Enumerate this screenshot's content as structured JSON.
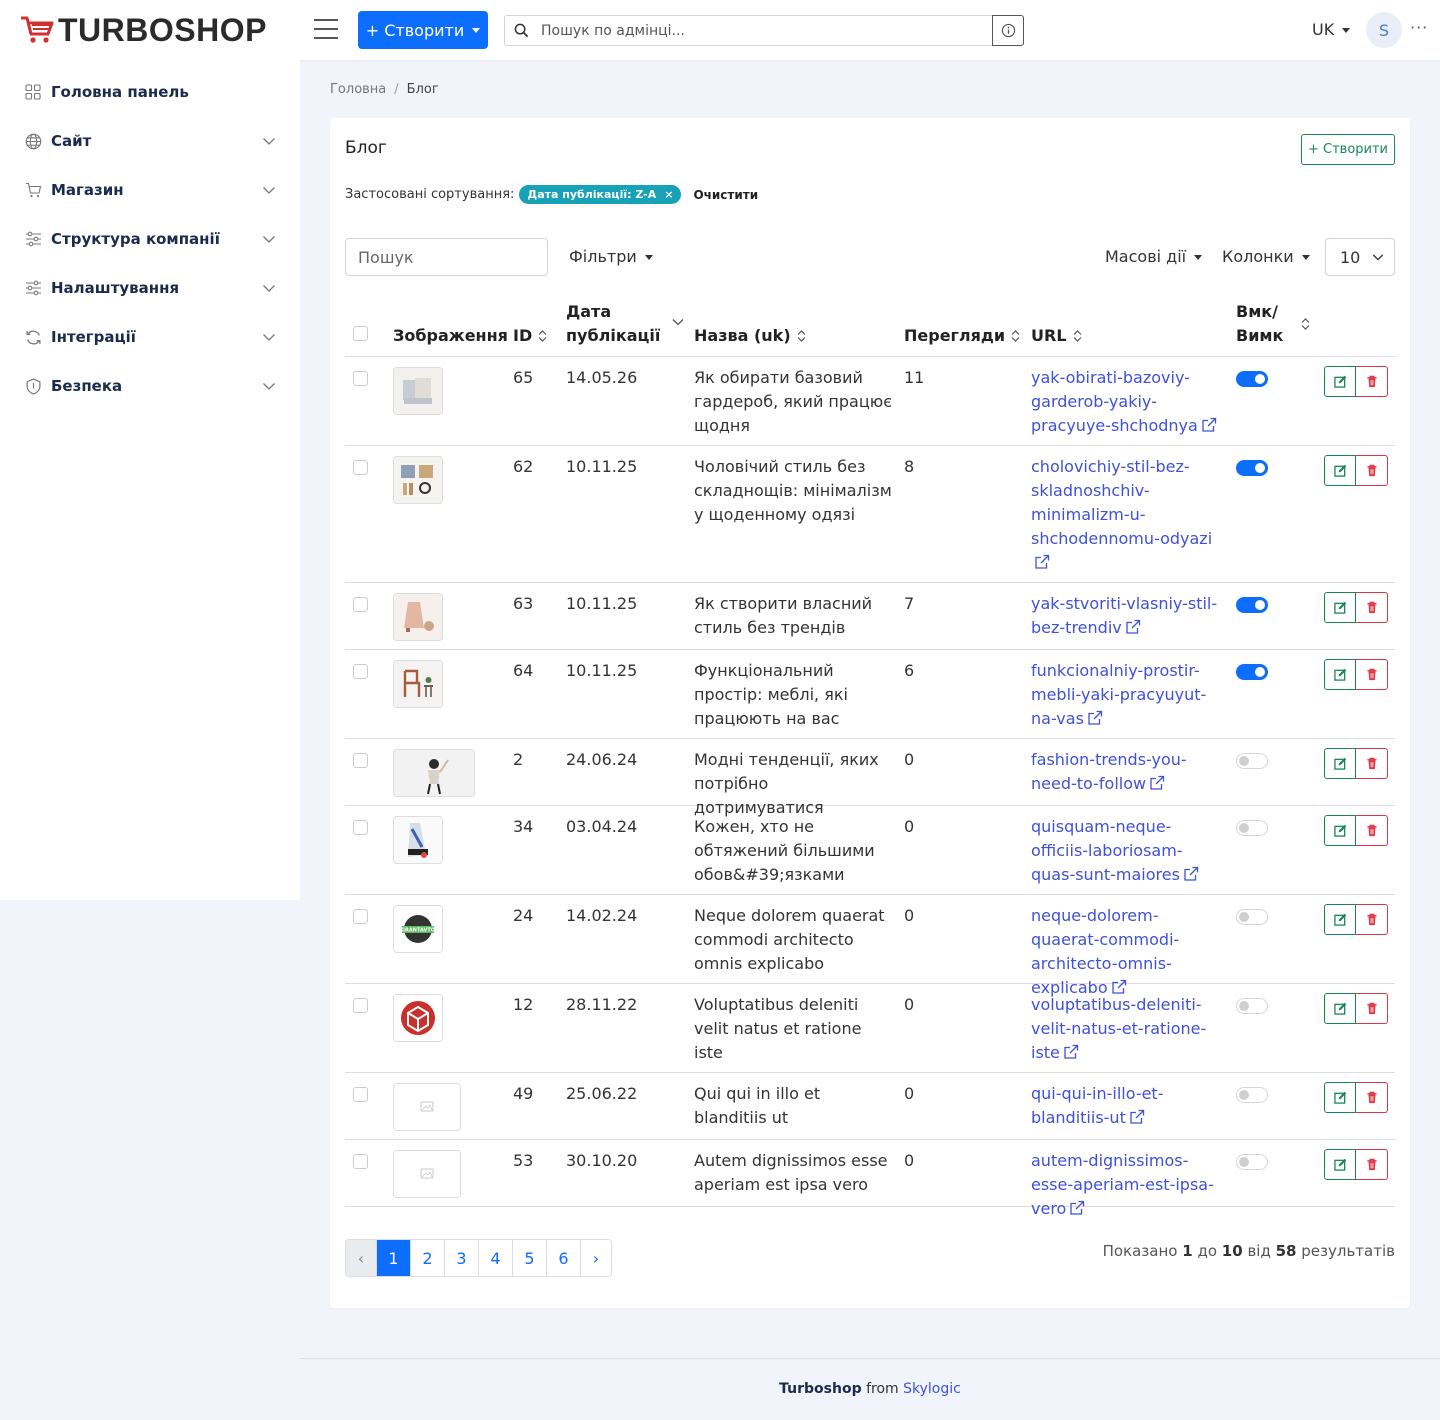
{
  "header": {
    "logo_text": "TURBOSHOP",
    "create_label": "+ Створити",
    "search_placeholder": "Пошук по адмінці...",
    "lang": "UK",
    "avatar_initial": "S",
    "more": "···"
  },
  "sidebar": {
    "items": [
      {
        "label": "Головна панель",
        "icon": "grid-icon",
        "has_children": false
      },
      {
        "label": "Сайт",
        "icon": "globe-icon",
        "has_children": true
      },
      {
        "label": "Магазин",
        "icon": "cart-icon",
        "has_children": true
      },
      {
        "label": "Структура компанії",
        "icon": "sliders-icon",
        "has_children": true
      },
      {
        "label": "Налаштування",
        "icon": "sliders-icon",
        "has_children": true
      },
      {
        "label": "Інтеграції",
        "icon": "sync-icon",
        "has_children": true
      },
      {
        "label": "Безпека",
        "icon": "shield-icon",
        "has_children": true
      }
    ]
  },
  "breadcrumb": {
    "home": "Головна",
    "sep": "/",
    "current": "Блог"
  },
  "card": {
    "title": "Блог",
    "create_label": "+ Створити",
    "applied_sorts_label": "Застосовані сортування:",
    "sort_badge": "Дата публікації: Z-A",
    "sort_badge_close": "×",
    "clear_label": "Очистити",
    "search_placeholder": "Пошук",
    "filters_label": "Фільтри",
    "bulk_label": "Масові дії",
    "columns_label": "Колонки",
    "per_page": "10"
  },
  "table": {
    "columns": {
      "image": "Зображення",
      "id": "ID",
      "date_1": "Дата",
      "date_2": "публікації",
      "name": "Назва (uk)",
      "views": "Перегляди",
      "url": "URL",
      "toggle_1": "Вмк/",
      "toggle_2": "Вимк"
    },
    "rows": [
      {
        "id": "65",
        "date": "14.05.26",
        "name": "Як обирати базовий гардероб, який працює щодня",
        "views": "11",
        "url": "yak-obirati-bazoviy-garderob-yakiy-pracyuye-shchodnya",
        "enabled": true,
        "thumb": "clothes"
      },
      {
        "id": "62",
        "date": "10.11.25",
        "name": "Чоловічий стиль без складнощів: мінімалізм у щоденному одязі",
        "views": "8",
        "url": "cholovichiy-stil-bez-skladnoshchiv-minimalizm-u-shchodennomu-odyazi",
        "enabled": true,
        "thumb": "menswear"
      },
      {
        "id": "63",
        "date": "10.11.25",
        "name": "Як створити власний стиль без трендів",
        "views": "7",
        "url": "yak-stvoriti-vlasniy-stil-bez-trendiv",
        "enabled": true,
        "thumb": "dress"
      },
      {
        "id": "64",
        "date": "10.11.25",
        "name": "Функціональний простір: меблі, які працюють на вас",
        "views": "6",
        "url": "funkcionalniy-prostir-mebli-yaki-pracyuyut-na-vas",
        "enabled": true,
        "thumb": "chair"
      },
      {
        "id": "2",
        "date": "24.06.24",
        "name": "Модні тенденції, яких потрібно дотримуватися",
        "views": "0",
        "url": "fashion-trends-you-need-to-follow",
        "enabled": false,
        "thumb": "model"
      },
      {
        "id": "34",
        "date": "03.04.24",
        "name": "Кожен, хто не обтяжений більшими обов&#39;язками",
        "views": "0",
        "url": "quisquam-neque-officiis-laboriosam-quas-sunt-maiores",
        "enabled": false,
        "thumb": "sport"
      },
      {
        "id": "24",
        "date": "14.02.24",
        "name": "Neque dolorem quaerat commodi architecto omnis explicabo",
        "views": "0",
        "url": "neque-dolorem-quaerat-commodi-architecto-omnis-explicabo",
        "enabled": false,
        "thumb": "logo-green"
      },
      {
        "id": "12",
        "date": "28.11.22",
        "name": "Voluptatibus deleniti velit natus et ratione iste",
        "views": "0",
        "url": "voluptatibus-deleniti-velit-natus-et-ratione-iste",
        "enabled": false,
        "thumb": "logo-red"
      },
      {
        "id": "49",
        "date": "25.06.22",
        "name": "Qui qui in illo et blanditiis ut",
        "views": "0",
        "url": "qui-qui-in-illo-et-blanditiis-ut",
        "enabled": false,
        "thumb": "placeholder"
      },
      {
        "id": "53",
        "date": "30.10.20",
        "name": "Autem dignissimos esse aperiam est ipsa vero",
        "views": "0",
        "url": "autem-dignissimos-esse-aperiam-est-ipsa-vero",
        "enabled": false,
        "thumb": "placeholder"
      }
    ]
  },
  "pagination": {
    "prev": "‹",
    "pages": [
      "1",
      "2",
      "3",
      "4",
      "5",
      "6"
    ],
    "current": "1",
    "next": "›",
    "summary_prefix": "Показано",
    "from": "1",
    "to_word": "до",
    "to": "10",
    "of_word": "від",
    "total": "58",
    "suffix": "результатів"
  },
  "footer": {
    "brand": "Turboshop",
    "from": "from",
    "company": "Skylogic"
  },
  "colors": {
    "primary": "#0d6efd",
    "success": "#198754",
    "danger": "#dc3545",
    "info": "#17a2b8",
    "link": "#3f51d8"
  }
}
